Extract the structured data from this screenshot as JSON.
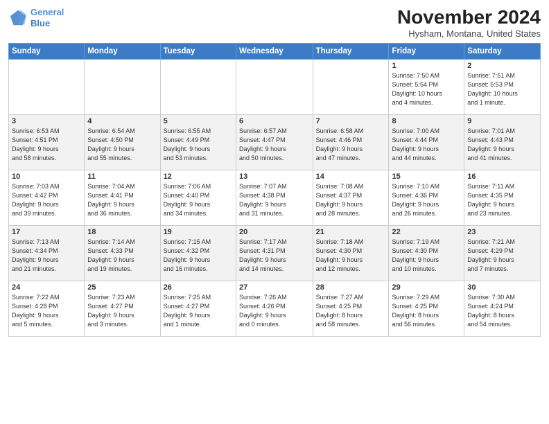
{
  "logo": {
    "line1": "General",
    "line2": "Blue"
  },
  "title": "November 2024",
  "subtitle": "Hysham, Montana, United States",
  "days_of_week": [
    "Sunday",
    "Monday",
    "Tuesday",
    "Wednesday",
    "Thursday",
    "Friday",
    "Saturday"
  ],
  "weeks": [
    [
      {
        "day": "",
        "info": ""
      },
      {
        "day": "",
        "info": ""
      },
      {
        "day": "",
        "info": ""
      },
      {
        "day": "",
        "info": ""
      },
      {
        "day": "",
        "info": ""
      },
      {
        "day": "1",
        "info": "Sunrise: 7:50 AM\nSunset: 5:54 PM\nDaylight: 10 hours\nand 4 minutes."
      },
      {
        "day": "2",
        "info": "Sunrise: 7:51 AM\nSunset: 5:53 PM\nDaylight: 10 hours\nand 1 minute."
      }
    ],
    [
      {
        "day": "3",
        "info": "Sunrise: 6:53 AM\nSunset: 4:51 PM\nDaylight: 9 hours\nand 58 minutes."
      },
      {
        "day": "4",
        "info": "Sunrise: 6:54 AM\nSunset: 4:50 PM\nDaylight: 9 hours\nand 55 minutes."
      },
      {
        "day": "5",
        "info": "Sunrise: 6:55 AM\nSunset: 4:49 PM\nDaylight: 9 hours\nand 53 minutes."
      },
      {
        "day": "6",
        "info": "Sunrise: 6:57 AM\nSunset: 4:47 PM\nDaylight: 9 hours\nand 50 minutes."
      },
      {
        "day": "7",
        "info": "Sunrise: 6:58 AM\nSunset: 4:46 PM\nDaylight: 9 hours\nand 47 minutes."
      },
      {
        "day": "8",
        "info": "Sunrise: 7:00 AM\nSunset: 4:44 PM\nDaylight: 9 hours\nand 44 minutes."
      },
      {
        "day": "9",
        "info": "Sunrise: 7:01 AM\nSunset: 4:43 PM\nDaylight: 9 hours\nand 41 minutes."
      }
    ],
    [
      {
        "day": "10",
        "info": "Sunrise: 7:03 AM\nSunset: 4:42 PM\nDaylight: 9 hours\nand 39 minutes."
      },
      {
        "day": "11",
        "info": "Sunrise: 7:04 AM\nSunset: 4:41 PM\nDaylight: 9 hours\nand 36 minutes."
      },
      {
        "day": "12",
        "info": "Sunrise: 7:06 AM\nSunset: 4:40 PM\nDaylight: 9 hours\nand 34 minutes."
      },
      {
        "day": "13",
        "info": "Sunrise: 7:07 AM\nSunset: 4:38 PM\nDaylight: 9 hours\nand 31 minutes."
      },
      {
        "day": "14",
        "info": "Sunrise: 7:08 AM\nSunset: 4:37 PM\nDaylight: 9 hours\nand 28 minutes."
      },
      {
        "day": "15",
        "info": "Sunrise: 7:10 AM\nSunset: 4:36 PM\nDaylight: 9 hours\nand 26 minutes."
      },
      {
        "day": "16",
        "info": "Sunrise: 7:11 AM\nSunset: 4:35 PM\nDaylight: 9 hours\nand 23 minutes."
      }
    ],
    [
      {
        "day": "17",
        "info": "Sunrise: 7:13 AM\nSunset: 4:34 PM\nDaylight: 9 hours\nand 21 minutes."
      },
      {
        "day": "18",
        "info": "Sunrise: 7:14 AM\nSunset: 4:33 PM\nDaylight: 9 hours\nand 19 minutes."
      },
      {
        "day": "19",
        "info": "Sunrise: 7:15 AM\nSunset: 4:32 PM\nDaylight: 9 hours\nand 16 minutes."
      },
      {
        "day": "20",
        "info": "Sunrise: 7:17 AM\nSunset: 4:31 PM\nDaylight: 9 hours\nand 14 minutes."
      },
      {
        "day": "21",
        "info": "Sunrise: 7:18 AM\nSunset: 4:30 PM\nDaylight: 9 hours\nand 12 minutes."
      },
      {
        "day": "22",
        "info": "Sunrise: 7:19 AM\nSunset: 4:30 PM\nDaylight: 9 hours\nand 10 minutes."
      },
      {
        "day": "23",
        "info": "Sunrise: 7:21 AM\nSunset: 4:29 PM\nDaylight: 9 hours\nand 7 minutes."
      }
    ],
    [
      {
        "day": "24",
        "info": "Sunrise: 7:22 AM\nSunset: 4:28 PM\nDaylight: 9 hours\nand 5 minutes."
      },
      {
        "day": "25",
        "info": "Sunrise: 7:23 AM\nSunset: 4:27 PM\nDaylight: 9 hours\nand 3 minutes."
      },
      {
        "day": "26",
        "info": "Sunrise: 7:25 AM\nSunset: 4:27 PM\nDaylight: 9 hours\nand 1 minute."
      },
      {
        "day": "27",
        "info": "Sunrise: 7:26 AM\nSunset: 4:26 PM\nDaylight: 9 hours\nand 0 minutes."
      },
      {
        "day": "28",
        "info": "Sunrise: 7:27 AM\nSunset: 4:25 PM\nDaylight: 8 hours\nand 58 minutes."
      },
      {
        "day": "29",
        "info": "Sunrise: 7:29 AM\nSunset: 4:25 PM\nDaylight: 8 hours\nand 56 minutes."
      },
      {
        "day": "30",
        "info": "Sunrise: 7:30 AM\nSunset: 4:24 PM\nDaylight: 8 hours\nand 54 minutes."
      }
    ]
  ]
}
